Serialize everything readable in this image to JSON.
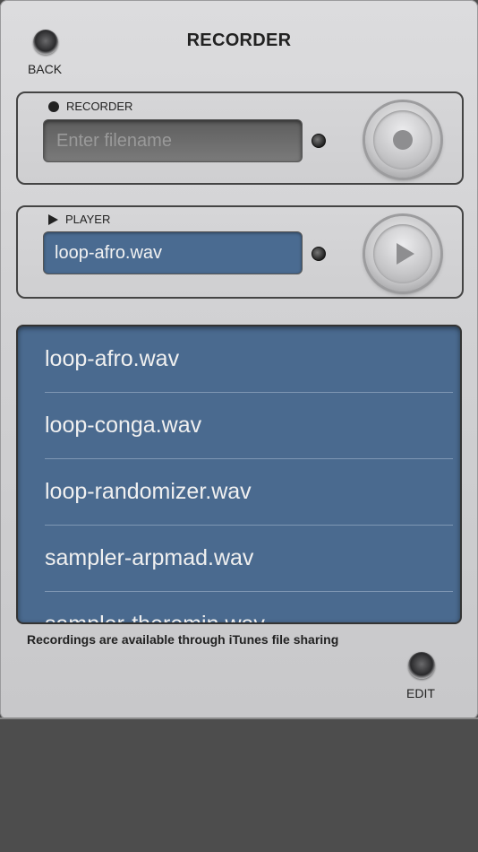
{
  "header": {
    "title": "RECORDER",
    "back_label": "BACK",
    "edit_label": "EDIT"
  },
  "recorder": {
    "label": "RECORDER",
    "filename_placeholder": "Enter filename",
    "filename_value": ""
  },
  "player": {
    "label": "PLAYER",
    "selected_file": "loop-afro.wav"
  },
  "files": [
    "loop-afro.wav",
    "loop-conga.wav",
    "loop-randomizer.wav",
    "sampler-arpmad.wav",
    "sampler-theremin.wav"
  ],
  "footer_note": "Recordings are available through iTunes file sharing",
  "colors": {
    "list_background": "#4a6a8f",
    "panel": "#d3d3d5",
    "outer_background": "#4d4d4d"
  }
}
